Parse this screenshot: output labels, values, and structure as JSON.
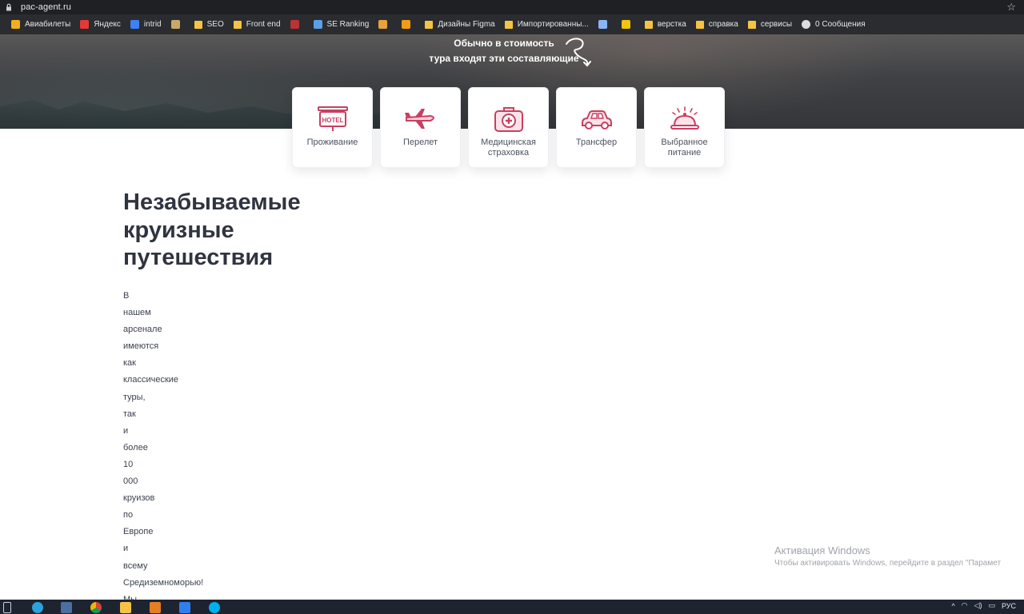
{
  "browser": {
    "url": "pac-agent.ru",
    "bookmarks": [
      {
        "label": "Авиабилеты",
        "icon": "plane-bookmark-icon",
        "type": "site"
      },
      {
        "label": "Яндекс",
        "icon": "yandex-icon",
        "type": "site"
      },
      {
        "label": "intrid",
        "icon": "intrid-icon",
        "type": "site"
      },
      {
        "label": "",
        "icon": "image-bookmark-icon",
        "type": "site"
      },
      {
        "label": "SEO",
        "icon": "folder-icon",
        "type": "folder"
      },
      {
        "label": "Front end",
        "icon": "folder-icon",
        "type": "folder"
      },
      {
        "label": "",
        "icon": "code-bookmark-icon",
        "type": "site"
      },
      {
        "label": "SE Ranking",
        "icon": "se-ranking-icon",
        "type": "site"
      },
      {
        "label": "",
        "icon": "bar-chart-icon",
        "type": "site"
      },
      {
        "label": "",
        "icon": "square-bookmark-icon",
        "type": "site"
      },
      {
        "label": "Дизайны Figma",
        "icon": "folder-icon",
        "type": "folder"
      },
      {
        "label": "Импортированны...",
        "icon": "folder-icon",
        "type": "folder"
      },
      {
        "label": "",
        "icon": "cube-bookmark-icon",
        "type": "site"
      },
      {
        "label": "",
        "icon": "lightning-bookmark-icon",
        "type": "site"
      },
      {
        "label": "верстка",
        "icon": "folder-icon",
        "type": "folder"
      },
      {
        "label": "справка",
        "icon": "folder-icon",
        "type": "folder"
      },
      {
        "label": "сервисы",
        "icon": "folder-icon",
        "type": "folder"
      },
      {
        "label": "0 Сообщения",
        "icon": "messages-icon",
        "type": "site"
      }
    ]
  },
  "hero": {
    "line1": "Обычно в стоимость",
    "line2": "тура входят эти составляющие"
  },
  "services": [
    {
      "label": "Проживание",
      "icon": "hotel-sign-icon"
    },
    {
      "label": "Перелет",
      "icon": "airplane-icon"
    },
    {
      "label": "Медицинская страховка",
      "icon": "medical-kit-icon"
    },
    {
      "label": "Трансфер",
      "icon": "car-icon"
    },
    {
      "label": "Выбранное питание",
      "icon": "food-cloche-icon"
    }
  ],
  "section": {
    "heading_lines": [
      "Незабываемые",
      "круизные",
      "путешествия"
    ],
    "words": [
      "В",
      "нашем",
      "арсенале",
      "имеются",
      "как",
      "классические",
      "туры,",
      "так",
      "и",
      "более",
      "10",
      "000",
      "круизов",
      "по",
      "Европе",
      "и",
      "всему",
      "Средиземноморью!",
      "Мы"
    ]
  },
  "watermark": {
    "title": "Активация Windows",
    "subtitle": "Чтобы активировать Windows, перейдите в раздел \"Парамет"
  },
  "taskbar": {
    "tray_lang": "РУС"
  },
  "colors": {
    "accent_icon": "#c93f61",
    "heading": "#2f3440"
  }
}
